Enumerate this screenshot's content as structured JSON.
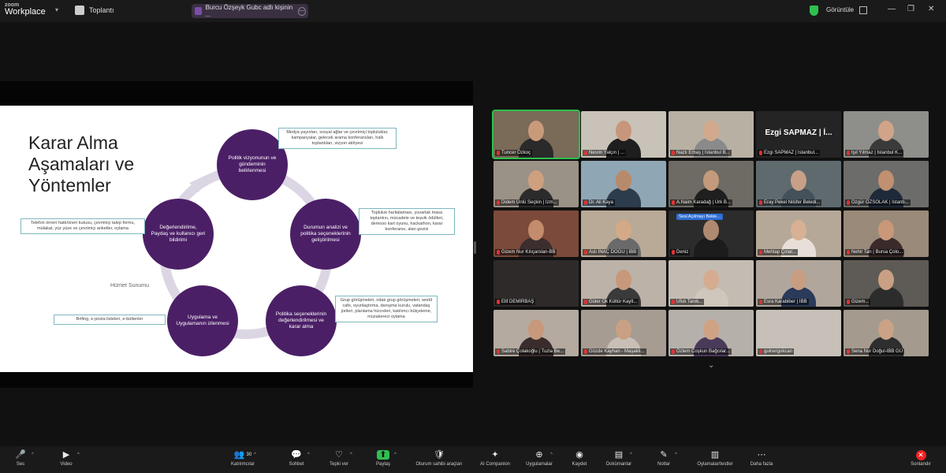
{
  "app": {
    "logo_top": "zoom",
    "logo_bottom": "Workplace"
  },
  "topbar": {
    "meeting_info": "Toplantı",
    "tab_label": "Burcu Özşeyk Gubc adlı kişinin ...",
    "view_button": "Görüntüle"
  },
  "slide": {
    "title": "Karar Alma Aşamaları ve Yöntemler",
    "credit": "Hürriet Sunumu",
    "stages": [
      "Politik vizyonunun ve gündeminin belirlenmesi",
      "Durumun analizi ve politika seçeneklerinin geliştirilmesi",
      "Politika seçeneklerinin değerlendirilmesi ve karar alma",
      "Uygulama ve Uygulamanın izlenmesi",
      "Değerlendirilme, Paydaş ve kullanıcı geri bildirimi"
    ],
    "notes": [
      "Medya yayınları, sosyal ağlar ve çevrimiçi topluluklar, kampanyalar, gelecek arama konferansları, halk toplantıları, vizyon atölyesi",
      "Topluluk haritalaması, yuvarlak masa toplantısı, mücadele ve teşvik ödülleri, demoso kart oyunu, hackathon, karar konferansı, alan gezisi",
      "Grup görüşmeleri, odak grup görüşmeleri, world cafe, oyunlaştırma, danışma kurulu, vatandaş jürileri, planlama hücreleri, katılımcı bütçeleme, müzakereci oylama",
      "Brifing, e-posta listeleri, e-bültenler",
      "Telefon örneri hattı/öneri kutusu, çevrimiçi talep formu, mülakat, yüz yüze ve çevrimiçi anketler, oylama"
    ]
  },
  "participants": [
    {
      "name": "Tuncer Özkoç",
      "active": true,
      "bg": "#7a6a58",
      "skin": "#c99a7a",
      "shirt": "#2a2a2a"
    },
    {
      "name": "Nesrin Yalçın | ...",
      "bg": "#c9c2b8",
      "skin": "#c8967a",
      "shirt": "#1e1e1e"
    },
    {
      "name": "Nazlı Erbaş | İstanbul B...",
      "bg": "#b9b0a4",
      "skin": "#d2a98c",
      "shirt": "#8a8a8a"
    },
    {
      "name": "Ezgi SAPMAZ | İstanbul...",
      "big": "Ezgi SAPMAZ | İ...",
      "bg": "#242424"
    },
    {
      "name": "Işıl Yılmaz | İstanbul K...",
      "bg": "#8e8e8a",
      "skin": "#d0a488",
      "shirt": "#3a3a3a"
    },
    {
      "name": "Didem Ünlü Seçkin | İzm...",
      "bg": "#9a9286",
      "skin": "#cfa07e",
      "shirt": "#2b2b2b"
    },
    {
      "name": "Dr. Ali Kaya",
      "bg": "#8fa6b4",
      "skin": "#b88a6c",
      "shirt": "#2c3c4c"
    },
    {
      "name": "A.Naim Karadağ | Ürk B...",
      "bg": "#6e6a64",
      "skin": "#c49a7c",
      "shirt": "#1f1f1f"
    },
    {
      "name": "Eray Pekel Nilüfer Beledi...",
      "bg": "#5e6a6e",
      "skin": "#c8a088",
      "shirt": "#44505a"
    },
    {
      "name": "Özgür ÖZSOLAK | İstanb...",
      "bg": "#6c6c6a",
      "skin": "#c09070",
      "shirt": "#1e2a3a"
    },
    {
      "name": "Gizem Nur Kılıçarslan-BB",
      "bg": "#7c4a3a",
      "skin": "#c48c6c",
      "shirt": "#3c2e2e"
    },
    {
      "name": "Aslı İNAÇ DOĞU | İBB",
      "bg": "#b8aa96",
      "skin": "#d4a988",
      "shirt": "#6a6a6a"
    },
    {
      "name": "Deniz",
      "tag": "Sesi Açılmayı Bekle...",
      "bg": "#2c2c2c",
      "skin": "#b08a70",
      "shirt": "#1c1c1c"
    },
    {
      "name": "Mehtap Çınar...",
      "bg": "#b6a898",
      "skin": "#d8b094",
      "shirt": "#e8e0d8"
    },
    {
      "name": "Nehir Tan | Bursa Çolo...",
      "bg": "#9a8a7a",
      "skin": "#c89878",
      "shirt": "#3a2a2a"
    },
    {
      "name": "Elif DEMİRBAŞ",
      "bg": "#2e2a2a",
      "skin": "#2e2a2a",
      "shirt": "#2e2a2a"
    },
    {
      "name": "Güler Ok Kültür Kayit...",
      "bg": "#bcb2a8",
      "skin": "#c8987a",
      "shirt": "#3a3a3a"
    },
    {
      "name": "Ufuk Tanık...",
      "bg": "#c4bcb2",
      "skin": "#d6ac90",
      "shirt": "#cfc6bc"
    },
    {
      "name": "Esra Karabiber | İBB",
      "bg": "#b0a69c",
      "skin": "#c89e82",
      "shirt": "#2a3a5a"
    },
    {
      "name": "Gizem...",
      "bg": "#5e5a56",
      "skin": "#caa084",
      "shirt": "#2c2c2c"
    },
    {
      "name": "Sabire Çolakoğlu | Tuzla Be...",
      "bg": "#b4aaa0",
      "skin": "#c8987c",
      "shirt": "#3a2c2c"
    },
    {
      "name": "Gözde Kayhan - Maşaklı...",
      "bg": "#a69c92",
      "skin": "#caa084",
      "shirt": "#c8c0b6"
    },
    {
      "name": "Özlem Coşkun Bağcılar...",
      "bg": "#b6b0aa",
      "skin": "#d0a284",
      "shirt": "#4a3a5a"
    },
    {
      "name": "gulnergokcan",
      "bg": "#c6c0b8",
      "skin": "#c6c0b8",
      "shirt": "#c6c0b8"
    },
    {
      "name": "Sena Nur Doğul-İBB GÜ",
      "bg": "#a49a8e",
      "skin": "#caa286",
      "shirt": "#2e2e2e"
    }
  ],
  "toolbar": [
    {
      "icon": "🎤",
      "label": "Ses",
      "name": "audio-button",
      "caret": true,
      "slash": true
    },
    {
      "icon": "▶",
      "label": "Video",
      "name": "video-button",
      "caret": true
    },
    {
      "icon": "👥",
      "label": "Katılımcılar",
      "name": "participants-button",
      "caret": true,
      "count": "30"
    },
    {
      "icon": "💬",
      "label": "Sohbet",
      "name": "chat-button",
      "caret": true
    },
    {
      "icon": "♡",
      "label": "Tepki ver",
      "name": "react-button",
      "caret": true
    },
    {
      "icon": "⬆",
      "label": "Paylaş",
      "name": "share-button",
      "caret": true,
      "accent": true
    },
    {
      "icon": "🛡",
      "label": "Oturum sahibi araçları",
      "name": "host-tools-button"
    },
    {
      "icon": "✦",
      "label": "AI Companion",
      "name": "ai-companion-button"
    },
    {
      "icon": "⊕",
      "label": "Uygulamalar",
      "name": "apps-button",
      "caret": true
    },
    {
      "icon": "◉",
      "label": "Kaydet",
      "name": "record-button"
    },
    {
      "icon": "▤",
      "label": "Dokümanlar",
      "name": "docs-button",
      "caret": true
    },
    {
      "icon": "✎",
      "label": "Notlar",
      "name": "notes-button",
      "caret": true
    },
    {
      "icon": "▥",
      "label": "Oylamalar/testler",
      "name": "polls-button"
    },
    {
      "icon": "⋯",
      "label": "Daha fazla",
      "name": "more-button"
    },
    {
      "icon": "✕",
      "label": "Sonlandır",
      "name": "end-button",
      "end": true
    }
  ],
  "colors": {
    "accent_green": "#2fbf4f",
    "slide_purple": "#4b1f66",
    "end_red": "#e22222"
  }
}
